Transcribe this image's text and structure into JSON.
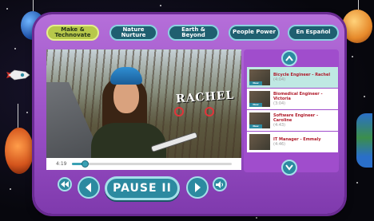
{
  "tabs": [
    {
      "label": "Make & Technovate",
      "active": true
    },
    {
      "label": "Nature Nurture",
      "active": false
    },
    {
      "label": "Earth & Beyond",
      "active": false
    },
    {
      "label": "People Power",
      "active": false
    },
    {
      "label": "En Español",
      "active": false
    }
  ],
  "video": {
    "overlay_text": "RACHEL",
    "current_time": "4:19",
    "progress_fraction": 0.08
  },
  "playlist": {
    "badge_label": "New",
    "items": [
      {
        "title": "Bicycle Engineer - Rachel",
        "duration": "(4:04)",
        "selected": true
      },
      {
        "title": "Biomedical Engineer - Victoria",
        "duration": "(3:04)",
        "selected": false
      },
      {
        "title": "Software Engineer - Caroline",
        "duration": "(4:43)",
        "selected": false
      },
      {
        "title": "IT Manager - Emmaly",
        "duration": "(4:46)",
        "selected": false
      }
    ]
  },
  "controls": {
    "pause_label": "PAUSE II"
  },
  "icons": {
    "rewind": "rewind-icon",
    "prev": "previous-icon",
    "next": "next-icon",
    "volume": "volume-icon",
    "scroll_up": "chevron-up-icon",
    "scroll_down": "chevron-down-icon"
  },
  "colors": {
    "frame": "#9a4fc6",
    "accent": "#2c8aa0",
    "active_tab": "#b7c84a",
    "title_red": "#b01a2a"
  }
}
